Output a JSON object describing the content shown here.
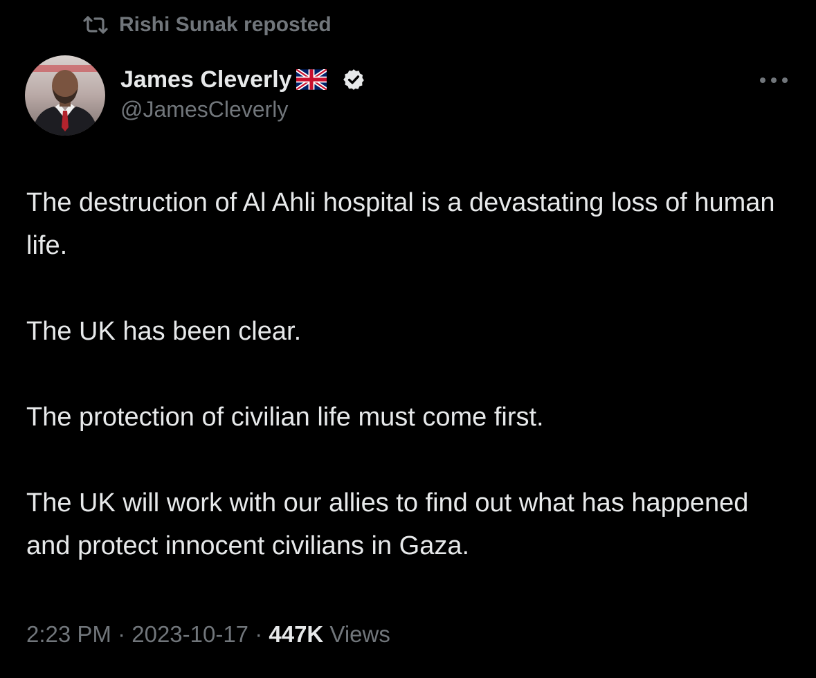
{
  "repost": {
    "icon": "repost-icon",
    "text": "Rishi Sunak reposted"
  },
  "author": {
    "display_name": "James Cleverly",
    "handle": "@JamesCleverly",
    "flag_icon": "uk-flag-icon",
    "verified_icon": "verified-badge-icon",
    "avatar_icon": "avatar-photo"
  },
  "more_menu": {
    "icon": "more-options-icon"
  },
  "tweet": {
    "paragraphs": [
      "The destruction of Al Ahli hospital is a devastating loss of human life.",
      "The UK has been clear.",
      "The protection of civilian life must come first.",
      "The UK will work with our allies to find out what has happened and protect innocent civilians in Gaza."
    ]
  },
  "meta": {
    "time": "2:23 PM",
    "separator": " · ",
    "date": "2023-10-17",
    "views_count": "447K",
    "views_label": " Views"
  },
  "colors": {
    "background": "#000000",
    "primary_text": "#e7e9ea",
    "secondary_text": "#71767b",
    "verified_badge": "#e7e9ea"
  }
}
